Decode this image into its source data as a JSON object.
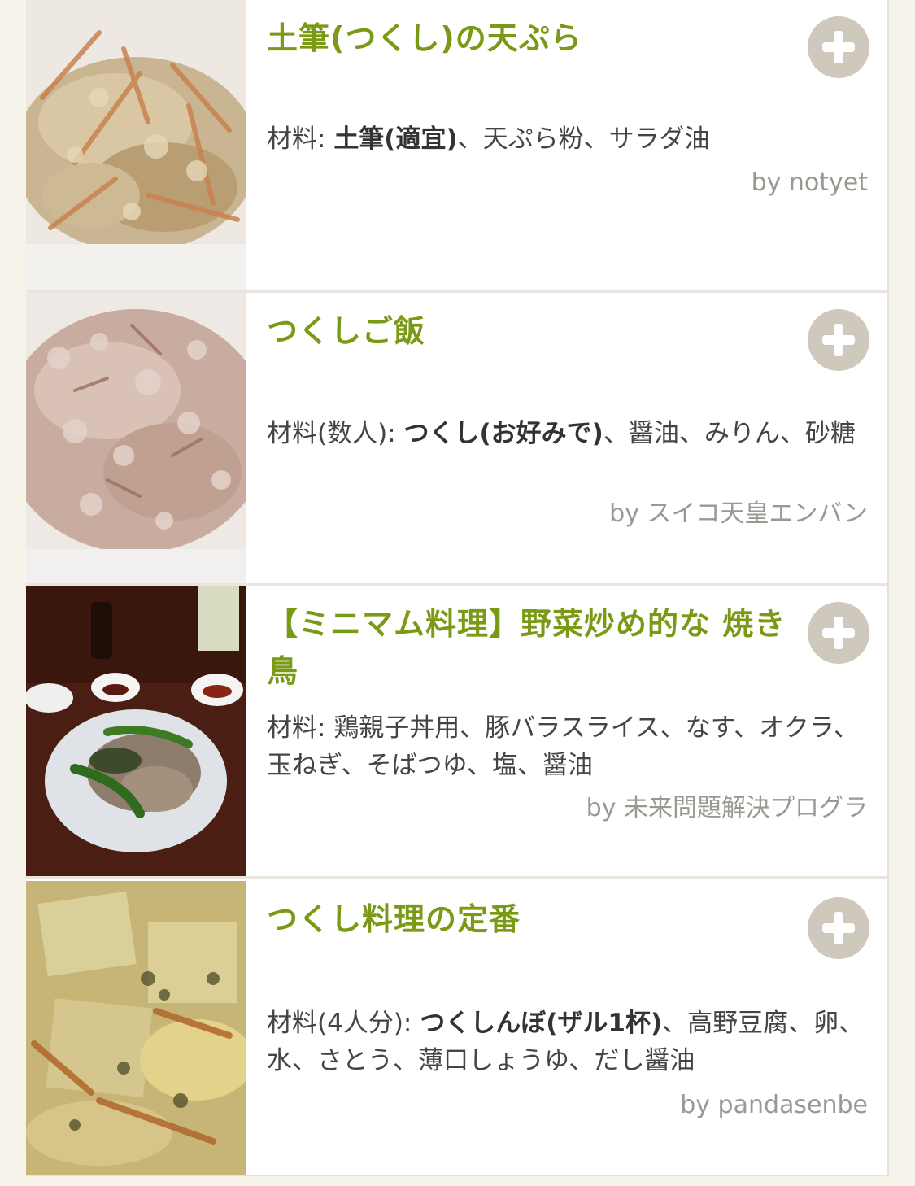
{
  "recipes": [
    {
      "title": "土筆(つくし)の天ぷら",
      "ingredients_label": "材料: ",
      "ingredients_bold": "土筆(適宜)",
      "ingredients_rest": "、天ぷら粉、サラダ油",
      "author": "by notyet"
    },
    {
      "title": "つくしご飯",
      "ingredients_label": "材料(数人): ",
      "ingredients_bold": "つくし(お好みで)",
      "ingredients_rest": "、醤油、みりん、砂糖",
      "author": "by スイコ天皇エンバン"
    },
    {
      "title": "【ミニマム料理】野菜炒め的な 焼き鳥",
      "ingredients_label": "材料: ",
      "ingredients_bold": "",
      "ingredients_rest": "鶏親子丼用、豚バラスライス、なす、オクラ、玉ねぎ、そばつゆ、塩、醤油",
      "author": "by 未来問題解決プログラ"
    },
    {
      "title": "つくし料理の定番",
      "ingredients_label": "材料(4人分): ",
      "ingredients_bold": "つくしんぼ(ザル1杯)",
      "ingredients_rest": "、高野豆腐、卵、水、さとう、薄口しょうゆ、だし醤油",
      "author": "by pandasenbe"
    }
  ],
  "icons": {
    "add": "plus-circle-icon"
  },
  "colors": {
    "title": "#7a9a16",
    "add_button": "#cfc8bc",
    "author": "#9a9890",
    "background": "#f5f3ea"
  }
}
